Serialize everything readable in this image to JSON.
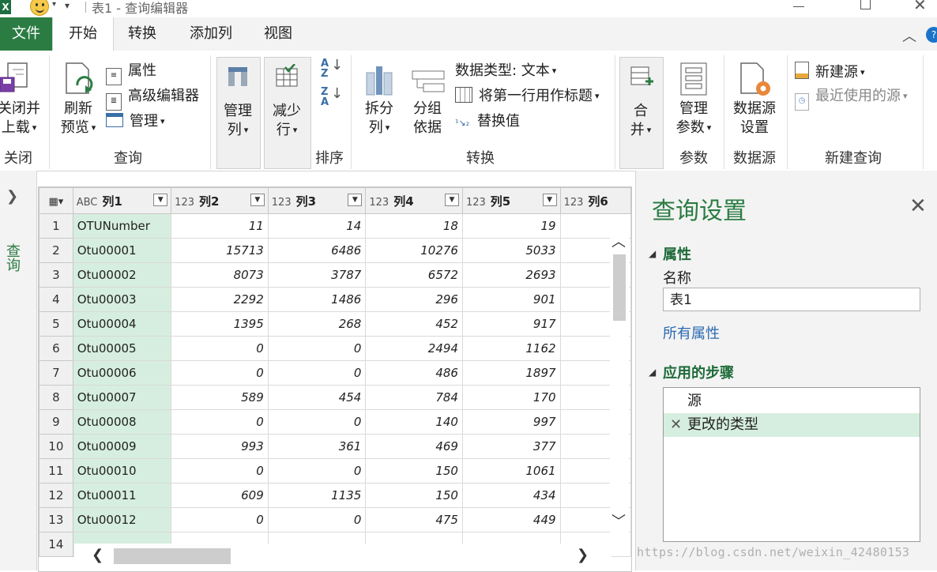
{
  "titlebar": {
    "app_icon": "excel-icon",
    "app_icon_letter": "X",
    "title": "表1 - 查询编辑器",
    "qa_caret": "▾",
    "qa_more": "▾"
  },
  "tabs": [
    {
      "label": "文件"
    },
    {
      "label": "开始"
    },
    {
      "label": "转换"
    },
    {
      "label": "添加列"
    },
    {
      "label": "视图"
    }
  ],
  "ribbon": {
    "close_group": {
      "button": [
        "关闭并",
        "上载"
      ],
      "label": "关闭"
    },
    "query_group": {
      "refresh": [
        "刷新",
        "预览"
      ],
      "properties": "属性",
      "advanced_editor": "高级编辑器",
      "manage": "管理",
      "label": "查询"
    },
    "manage_columns": [
      "管理",
      "列"
    ],
    "reduce_rows": [
      "减少",
      "行"
    ],
    "sort_label": "排序",
    "transform_group": {
      "split": [
        "拆分",
        "列"
      ],
      "group_by": [
        "分组",
        "依据"
      ],
      "data_type": "数据类型: 文本",
      "first_row_header": "将第一行用作标题",
      "replace_values": "替换值",
      "label": "转换"
    },
    "merge": [
      "合",
      "并"
    ],
    "params": {
      "button": [
        "管理",
        "参数"
      ],
      "label": "参数"
    },
    "datasource": {
      "button": [
        "数据源",
        "设置"
      ],
      "label": "数据源"
    },
    "new_query": {
      "new_source": "新建源",
      "recent_sources": "最近使用的源",
      "label": "新建查询"
    }
  },
  "left_panel": {
    "label": "查询"
  },
  "grid": {
    "columns": [
      {
        "type": "ABC",
        "name": "列1"
      },
      {
        "type": "123",
        "name": "列2"
      },
      {
        "type": "123",
        "name": "列3"
      },
      {
        "type": "123",
        "name": "列4"
      },
      {
        "type": "123",
        "name": "列5"
      },
      {
        "type": "123",
        "name": "列6"
      }
    ],
    "rows": [
      {
        "n": "1",
        "c1": "OTUNumber",
        "c2": "11",
        "c3": "14",
        "c4": "18",
        "c5": "19"
      },
      {
        "n": "2",
        "c1": "Otu00001",
        "c2": "15713",
        "c3": "6486",
        "c4": "10276",
        "c5": "5033"
      },
      {
        "n": "3",
        "c1": "Otu00002",
        "c2": "8073",
        "c3": "3787",
        "c4": "6572",
        "c5": "2693"
      },
      {
        "n": "4",
        "c1": "Otu00003",
        "c2": "2292",
        "c3": "1486",
        "c4": "296",
        "c5": "901"
      },
      {
        "n": "5",
        "c1": "Otu00004",
        "c2": "1395",
        "c3": "268",
        "c4": "452",
        "c5": "917"
      },
      {
        "n": "6",
        "c1": "Otu00005",
        "c2": "0",
        "c3": "0",
        "c4": "2494",
        "c5": "1162"
      },
      {
        "n": "7",
        "c1": "Otu00006",
        "c2": "0",
        "c3": "0",
        "c4": "486",
        "c5": "1897"
      },
      {
        "n": "8",
        "c1": "Otu00007",
        "c2": "589",
        "c3": "454",
        "c4": "784",
        "c5": "170"
      },
      {
        "n": "9",
        "c1": "Otu00008",
        "c2": "0",
        "c3": "0",
        "c4": "140",
        "c5": "997"
      },
      {
        "n": "10",
        "c1": "Otu00009",
        "c2": "993",
        "c3": "361",
        "c4": "469",
        "c5": "377"
      },
      {
        "n": "11",
        "c1": "Otu00010",
        "c2": "0",
        "c3": "0",
        "c4": "150",
        "c5": "1061"
      },
      {
        "n": "12",
        "c1": "Otu00011",
        "c2": "609",
        "c3": "1135",
        "c4": "150",
        "c5": "434"
      },
      {
        "n": "13",
        "c1": "Otu00012",
        "c2": "0",
        "c3": "0",
        "c4": "475",
        "c5": "449"
      },
      {
        "n": "14",
        "c1": "",
        "c2": "",
        "c3": "",
        "c4": "",
        "c5": ""
      }
    ]
  },
  "settings": {
    "title": "查询设置",
    "properties_section": "属性",
    "name_label": "名称",
    "name_value": "表1",
    "all_properties": "所有属性",
    "steps_section": "应用的步骤",
    "steps": [
      "源",
      "更改的类型"
    ]
  },
  "watermark": "https://blog.csdn.net/weixin_42480153",
  "colors": {
    "accent": "#2b7c43",
    "selected": "#d6eedf",
    "link": "#2a6ab0"
  }
}
